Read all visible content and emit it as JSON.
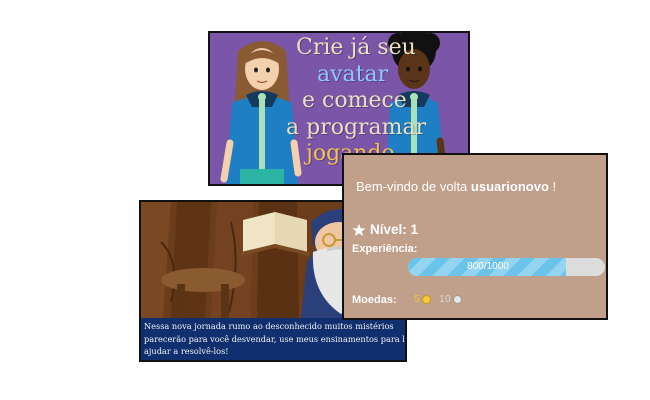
{
  "banner": {
    "lines": [
      "Crie já seu",
      "avatar",
      "e comece",
      "a programar",
      "jogando"
    ]
  },
  "story": {
    "dialog": [
      "Nessa nova jornada rumo ao desconhecido muitos mistérios",
      "parecerão para você desvendar, use meus ensinamentos para lhe",
      "ajudar a resolvê-los!"
    ]
  },
  "panel": {
    "welcome_prefix": "Bem-vindo de volta",
    "username": "usuarionovo",
    "welcome_suffix": "!",
    "level_label": "Nível: 1",
    "xp_label": "Experiência:",
    "xp_text": "800/1000",
    "xp_progress": 0.8,
    "coins_label": "Moedas:",
    "gold_coins": "5",
    "silver_coins": "10"
  },
  "colors": {
    "banner_bg": "#7a55a8",
    "panel_bg": "#c0a08a",
    "dialog_bg": "#0f2f6e",
    "xp_fill": "#6cc3ea",
    "gold": "#f2c530"
  },
  "icons": [
    "star-icon",
    "gold-coin-icon",
    "silver-coin-icon"
  ]
}
